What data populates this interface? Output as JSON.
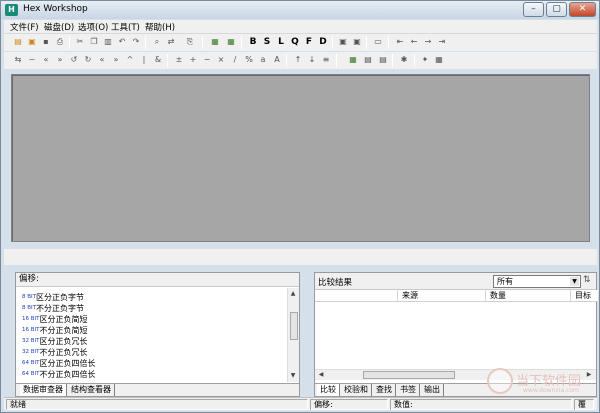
{
  "window": {
    "title": "Hex Workshop",
    "app_icon": "H"
  },
  "menubar": {
    "items": [
      "文件(F)",
      "磁盘(D)",
      "选项(O)",
      "工具(T)",
      "帮助(H)"
    ]
  },
  "toolbar1": {
    "letters": [
      "B",
      "S",
      "L",
      "Q",
      "F",
      "D"
    ]
  },
  "left_pane": {
    "header": "偏移:",
    "rows": [
      {
        "prefix": "8 BIT",
        "label": "区分正负字节"
      },
      {
        "prefix": "8 BIT",
        "label": "不分正负字节"
      },
      {
        "prefix": "16 BIT",
        "label": "区分正负简短"
      },
      {
        "prefix": "16 BIT",
        "label": "不分正负简短"
      },
      {
        "prefix": "32 BIT",
        "label": "区分正负冗长"
      },
      {
        "prefix": "32 BIT",
        "label": "不分正负冗长"
      },
      {
        "prefix": "64 BIT",
        "label": "区分正负四倍长"
      },
      {
        "prefix": "64 BIT",
        "label": "不分正负四倍长"
      }
    ],
    "tabs": [
      "数据审查器",
      "结构查看器"
    ]
  },
  "right_pane": {
    "header": "比较结果",
    "select_value": "所有",
    "columns": [
      "来源",
      "数量",
      "目标"
    ],
    "tabs": [
      "比较",
      "校验和",
      "查找",
      "书签",
      "输出"
    ]
  },
  "statusbar": {
    "ready": "就绪",
    "offset": "偏移:",
    "value": "数值:",
    "mode": "覆"
  },
  "watermark": {
    "text": "当下软件园",
    "url": "www.downxia.com"
  }
}
